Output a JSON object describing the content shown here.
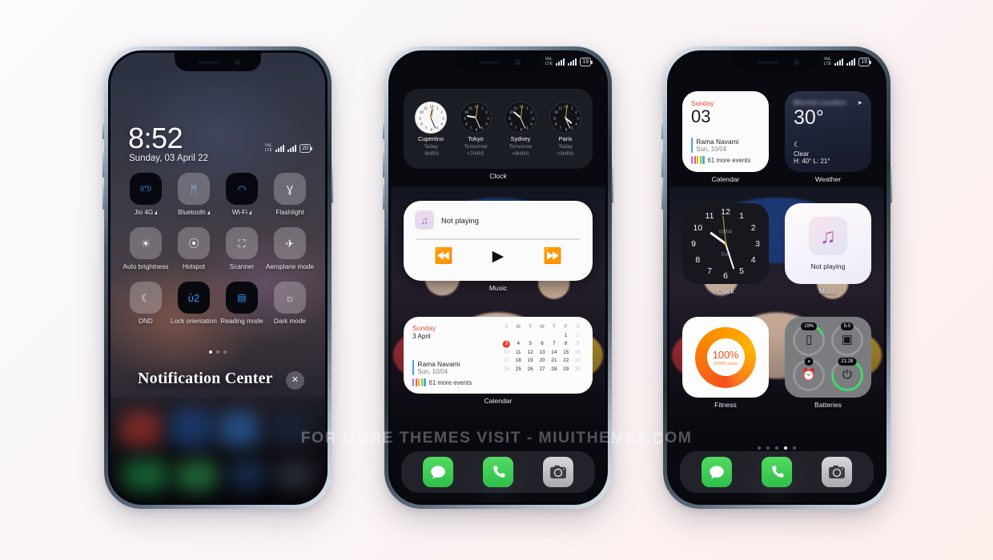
{
  "watermark": "FOR MORE THEMES VISIT - MIUITHEMEZ.COM",
  "phone1": {
    "statusbar": {
      "volte_top": "VoL",
      "volte_bottom": "LTE",
      "battery": "20"
    },
    "lock": {
      "time": "8:52",
      "date": "Sunday, 03 April 22"
    },
    "control_center": {
      "title": "Notification Center",
      "close_label": "✕",
      "toggles": [
        {
          "label": "Jio 4G",
          "icon": "cellular-icon",
          "active": true,
          "arrow": true
        },
        {
          "label": "Bluetooth",
          "icon": "bluetooth-icon",
          "active": false,
          "arrow": true
        },
        {
          "label": "Wi-Fi",
          "icon": "wifi-icon",
          "active": true,
          "arrow": true
        },
        {
          "label": "Flashlight",
          "icon": "flashlight-icon",
          "active": false,
          "arrow": false
        },
        {
          "label": "Auto brightness",
          "icon": "brightness-icon",
          "active": false,
          "arrow": false
        },
        {
          "label": "Hotspot",
          "icon": "hotspot-icon",
          "active": false,
          "arrow": false
        },
        {
          "label": "Scanner",
          "icon": "scanner-icon",
          "active": false,
          "arrow": false
        },
        {
          "label": "Aeroplane mode",
          "icon": "airplane-icon",
          "active": false,
          "arrow": false
        },
        {
          "label": "DND",
          "icon": "moon-icon",
          "active": false,
          "arrow": false
        },
        {
          "label": "Lock orientation",
          "icon": "rotation-lock-icon",
          "active": true,
          "arrow": false
        },
        {
          "label": "Reading mode",
          "icon": "book-icon",
          "active": true,
          "arrow": false
        },
        {
          "label": "Dark mode",
          "icon": "dark-mode-icon",
          "active": false,
          "arrow": false
        }
      ],
      "page_dots": 3,
      "active_dot": 0
    }
  },
  "phone2": {
    "statusbar": {
      "volte_top": "VoL",
      "volte_bottom": "LTE",
      "battery": "19"
    },
    "widgets": [
      {
        "name": "clock-world",
        "label": "Clock",
        "cities": [
          {
            "name": "Cupertino",
            "day": "Today",
            "offset": "-9HRS",
            "face": "light",
            "hour": 11.9,
            "minute": 26,
            "second": 1
          },
          {
            "name": "Tokyo",
            "day": "Tomorrow",
            "offset": "+7HRS",
            "face": "dark",
            "hour": 8.9,
            "minute": 26,
            "second": 1
          },
          {
            "name": "Sydney",
            "day": "Tomorrow",
            "offset": "+8HRS",
            "face": "dark",
            "hour": 9.9,
            "minute": 26,
            "second": 1
          },
          {
            "name": "Paris",
            "day": "Today",
            "offset": "+0HRS",
            "face": "dark",
            "hour": 3.9,
            "minute": 26,
            "second": 1
          }
        ]
      },
      {
        "name": "music",
        "label": "Music",
        "track_title": "Not playing",
        "controls": {
          "prev": "⏪",
          "play": "▶",
          "next": "⏩"
        }
      },
      {
        "name": "calendar",
        "label": "Calendar",
        "weekday": "Sunday",
        "date_line": "3 April",
        "event": {
          "title": "Rama Navami",
          "sub": "Sun, 10/04"
        },
        "more_events": "61 more events",
        "dow_headers": [
          "S",
          "M",
          "T",
          "W",
          "T",
          "F",
          "S"
        ],
        "weeks": [
          [
            "",
            "",
            "",
            "",
            "",
            "1",
            "2"
          ],
          [
            "3",
            "4",
            "5",
            "6",
            "7",
            "8",
            "9"
          ],
          [
            "10",
            "11",
            "12",
            "13",
            "14",
            "15",
            "16"
          ],
          [
            "17",
            "18",
            "19",
            "20",
            "21",
            "22",
            "23"
          ],
          [
            "24",
            "25",
            "26",
            "27",
            "28",
            "29",
            "30"
          ]
        ],
        "today": "3"
      }
    ],
    "dock": [
      {
        "name": "phone-app",
        "icon": "phone-icon",
        "glyph": "✆"
      },
      {
        "name": "messages-app",
        "icon": "message-icon",
        "glyph": "●"
      },
      {
        "name": "chrome-app",
        "icon": "chrome-icon",
        "glyph": ""
      },
      {
        "name": "camera-app",
        "icon": "camera-icon",
        "glyph": "■"
      }
    ]
  },
  "phone3": {
    "statusbar": {
      "volte_top": "VoL",
      "volte_bottom": "LTE",
      "battery": "19"
    },
    "calendar": {
      "label": "Calendar",
      "weekday": "Sunday",
      "day_number": "03",
      "event": {
        "title": "Rama Navami",
        "sub": "Sun, 10/04"
      },
      "more_events": "61 more events"
    },
    "weather": {
      "label": "Weather",
      "location": "Blurred Location",
      "temperature": "30°",
      "condition": "Clear",
      "high_low": "H: 40° L: 21°",
      "icon": "moon-icon",
      "location_arrow": "➤"
    },
    "clock": {
      "label": "Clock",
      "date": "03/04",
      "day": "Sun",
      "hour": 9.75,
      "minute": 27,
      "second": 59
    },
    "music": {
      "label": "Music",
      "track_title": "Not playing"
    },
    "fitness": {
      "label": "Fitness",
      "percent": "100%",
      "steps": "15695 steps"
    },
    "batteries": {
      "label": "Batteries",
      "cells": [
        {
          "name": "phone-battery",
          "pill": "19%",
          "icon": "phone-icon",
          "glyph": "▯",
          "percent": 19
        },
        {
          "name": "sim-battery",
          "pill": "5.0",
          "icon": "sim-icon",
          "glyph": "▣",
          "percent": 0
        },
        {
          "name": "alarm-battery",
          "pill": "",
          "icon": "alarm-icon",
          "glyph": "⏰",
          "percent": 0
        },
        {
          "name": "power-battery",
          "pill": "21:28",
          "icon": "power-icon",
          "glyph": "⏻",
          "percent": 78
        }
      ]
    },
    "page_dots": 5,
    "active_dot": 3,
    "dock": [
      {
        "name": "phone-app",
        "icon": "phone-icon",
        "glyph": "✆"
      },
      {
        "name": "messages-app",
        "icon": "message-icon",
        "glyph": "●"
      },
      {
        "name": "chrome-app",
        "icon": "chrome-icon",
        "glyph": ""
      },
      {
        "name": "camera-app",
        "icon": "camera-icon",
        "glyph": "■"
      }
    ]
  }
}
